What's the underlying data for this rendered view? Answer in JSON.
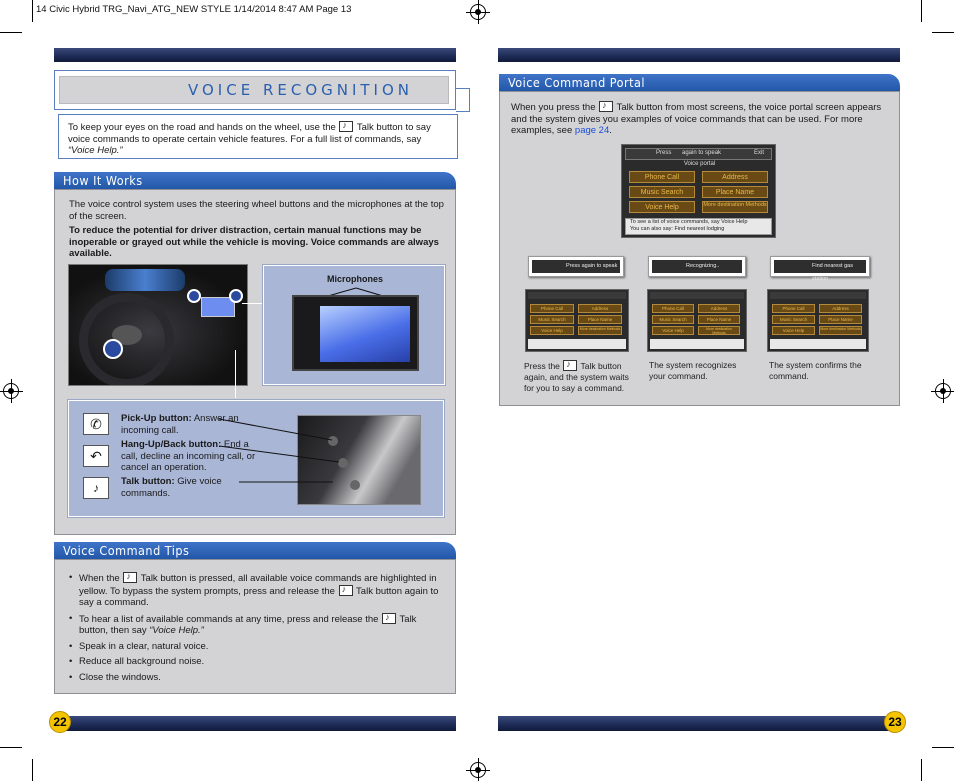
{
  "slug": "14 Civic Hybrid TRG_Navi_ATG_NEW STYLE  1/14/2014  8:47 AM  Page 13",
  "left_page": {
    "title": "VOICE RECOGNITION",
    "intro_pre": "To keep your eyes on the road and hands on the wheel, use the ",
    "intro_post": " Talk button to say voice commands to operate certain vehicle features. For a full list of commands, say ",
    "intro_quote": "“Voice Help.”",
    "how_it_works": {
      "heading": "How It Works",
      "para1": "The voice control system uses the steering wheel buttons and the microphones at the top of the screen.",
      "warning": "To reduce the potential for driver distraction, certain manual functions may be inoperable or grayed out while the vehicle is moving. Voice commands are always available.",
      "microphones_label": "Microphones",
      "buttons": [
        {
          "icon": "phone-pickup-icon",
          "name": "Pick-Up button:",
          "desc": " Answer an incoming call."
        },
        {
          "icon": "phone-hangup-icon",
          "name": "Hang-Up/Back button:",
          "desc": " End a call, decline an incoming call, or cancel an operation."
        },
        {
          "icon": "talk-icon",
          "name": "Talk button:",
          "desc": " Give voice commands."
        }
      ]
    },
    "tips": {
      "heading": "Voice Command Tips",
      "items": [
        {
          "pre": "When the ",
          "post": " Talk button is pressed, all available voice commands are highlighted in yellow. To bypass the system prompts, press and release the ",
          "post2": " Talk button again to say a command."
        },
        {
          "pre": "To hear a list of available commands at any time, press and release the ",
          "post": " Talk button, then say ",
          "quote": "“Voice Help.”"
        },
        {
          "pre": "Speak in a clear, natural voice."
        },
        {
          "pre": "Reduce all background noise."
        },
        {
          "pre": "Close the windows."
        }
      ]
    },
    "page_number": "22"
  },
  "right_page": {
    "portal": {
      "heading": "Voice Command Portal",
      "para_pre": "When you press the ",
      "para_post": " Talk button from most screens, the voice portal screen appears and the system gives you examples of voice commands that can be used. For more examples, see ",
      "link": "page 24",
      "para_end": ".",
      "screen": {
        "header_prompt": "Press",
        "header_prompt2": "again to speak",
        "exit": "Exit",
        "subtitle": "Voice portal",
        "buttons": [
          "Phone Call",
          "Address",
          "Music Search",
          "Place Name",
          "Voice Help",
          "More destination Methods"
        ],
        "footer1": "To see a list of voice commands, say  Voice Help",
        "footer2": "You can also say: Find nearest lodging"
      },
      "steps": [
        {
          "banner": "again to speak",
          "banner_pre": "Press",
          "caption_pre": "Press the ",
          "caption_post": " Talk button again, and the system waits for you to say a command."
        },
        {
          "banner": "Recognizing..",
          "banner_pre": "",
          "caption_pre": "The system recognizes your command.",
          "caption_post": ""
        },
        {
          "banner": "Find nearest gas station",
          "banner_pre": "",
          "caption_pre": "The system confirms the command.",
          "caption_post": ""
        }
      ],
      "mini_buttons": [
        "Phone Call",
        "Address",
        "Music Search",
        "Place Name",
        "Voice Help",
        "More destination Methods"
      ]
    },
    "page_number": "23"
  },
  "colors": {
    "accent_blue": "#2257a8",
    "navy_bar": "#1c2a55",
    "gray_panel": "#d3d3d6",
    "page_badge": "#f5c400"
  }
}
